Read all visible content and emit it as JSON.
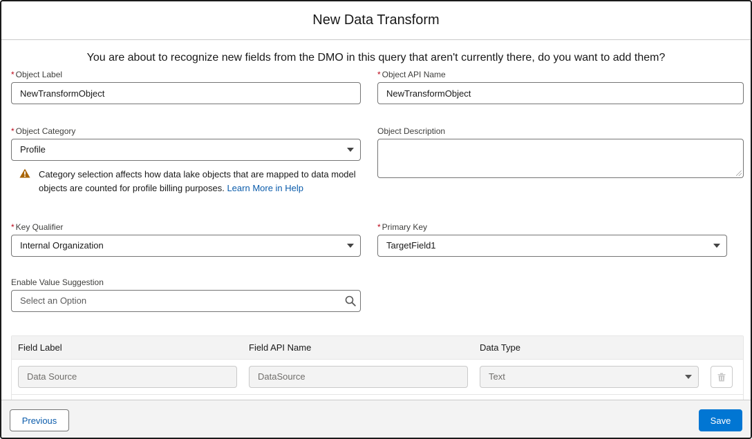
{
  "modal": {
    "title": "New Data Transform"
  },
  "intro": "You are about to recognize new fields from the DMO in this query that aren't currently there, do you want to add them?",
  "form": {
    "required_mark": "*",
    "object_label": {
      "label": "Object Label",
      "value": "NewTransformObject",
      "required": true
    },
    "object_api_name": {
      "label": "Object API Name",
      "value": "NewTransformObject",
      "required": true
    },
    "object_category": {
      "label": "Object Category",
      "value": "Profile",
      "required": true
    },
    "object_description": {
      "label": "Object Description",
      "value": ""
    },
    "warning": {
      "text": "Category selection affects how data lake objects that are mapped to data model objects are counted for profile billing purposes.",
      "link": "Learn More in Help",
      "icon": "warning-icon"
    },
    "key_qualifier": {
      "label": "Key Qualifier",
      "value": "Internal Organization",
      "required": true
    },
    "primary_key": {
      "label": "Primary Key",
      "value": "TargetField1",
      "required": true
    },
    "enable_value_suggestion": {
      "label": "Enable Value Suggestion",
      "placeholder": "Select an Option"
    }
  },
  "table": {
    "columns": [
      "Field Label",
      "Field API Name",
      "Data Type"
    ],
    "rows": [
      {
        "field_label": "Data Source",
        "field_api_name": "DataSource",
        "data_type": "Text"
      }
    ]
  },
  "footer": {
    "previous_label": "Previous",
    "save_label": "Save"
  },
  "colors": {
    "brand": "#0176d3",
    "link": "#0b5cab",
    "required": "#ba0517",
    "warning": "#a96404"
  }
}
